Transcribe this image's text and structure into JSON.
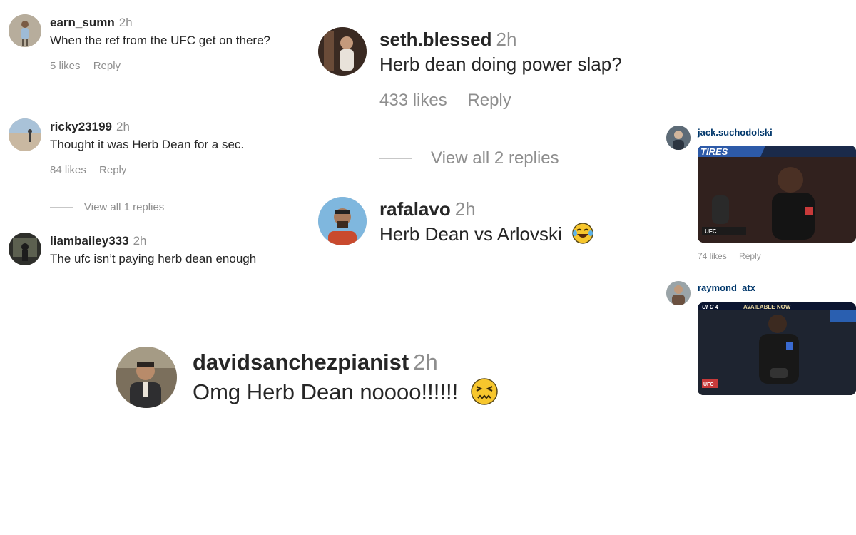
{
  "comments": [
    {
      "username": "earn_sumn",
      "time": "2h",
      "text": "When the ref from the UFC get on there?",
      "likes": "5 likes",
      "reply": "Reply"
    },
    {
      "username": "ricky23199",
      "time": "2h",
      "text": "Thought it was Herb Dean for a sec.",
      "likes": "84 likes",
      "reply": "Reply",
      "view_replies": "View all 1 replies"
    },
    {
      "username": "liambailey333",
      "time": "2h",
      "text": "The ufc isn’t paying herb dean enough"
    },
    {
      "username": "seth.blessed",
      "time": "2h",
      "text": "Herb dean doing power slap?",
      "likes": "433 likes",
      "reply": "Reply",
      "view_replies": "View all 2 replies"
    },
    {
      "username": "rafalavo",
      "time": "2h",
      "text": "Herb Dean vs Arlovski",
      "emoji": "laughing-tears-emoji"
    },
    {
      "username": "davidsanchezpianist",
      "time": "2h",
      "text": "Omg Herb Dean noooo!!!!!!",
      "emoji": "confounded-face-emoji"
    },
    {
      "username": "jack.suchodolski",
      "likes": "74 likes",
      "reply": "Reply",
      "gif_banner": "TIRES",
      "gif_badge": "UFC"
    },
    {
      "username": "raymond_atx",
      "gif_banner_left": "UFC 4",
      "gif_banner_right": "AVAILABLE NOW",
      "gif_badge": "UFC"
    }
  ],
  "colors": {
    "text": "#262626",
    "muted": "#8e8e8e",
    "link": "#00376b",
    "background": "#ffffff"
  }
}
